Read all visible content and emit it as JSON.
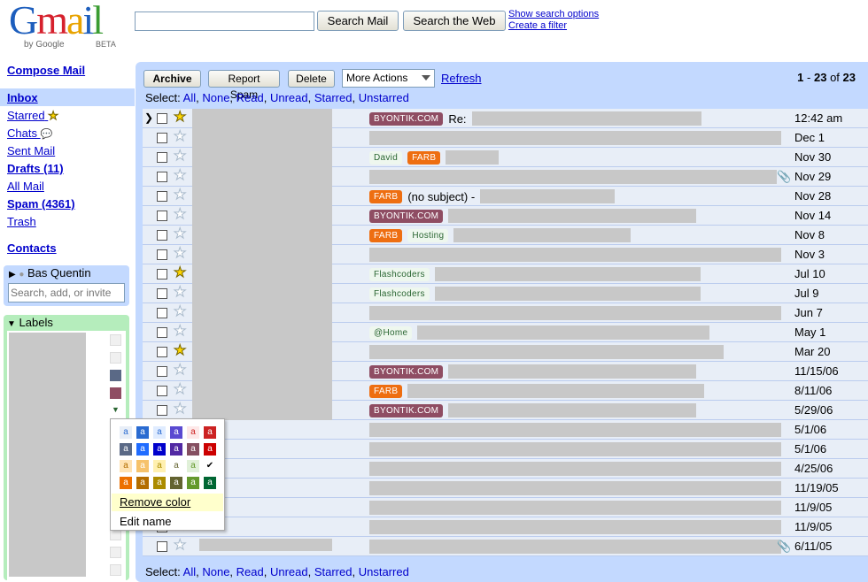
{
  "logo": {
    "text": "Gmail",
    "by": "by Google",
    "beta": "BETA"
  },
  "search": {
    "placeholder": "",
    "mail_button": "Search Mail",
    "web_button": "Search the Web",
    "options_link": "Show search options",
    "filter_link": "Create a filter"
  },
  "nav": {
    "compose": "Compose Mail",
    "inbox": "Inbox",
    "starred": "Starred",
    "chats": "Chats",
    "sent": "Sent Mail",
    "drafts": "Drafts (11)",
    "all": "All Mail",
    "spam": "Spam (4361)",
    "trash": "Trash",
    "contacts": "Contacts"
  },
  "chat": {
    "user": "Bas Quentin",
    "search_placeholder": "Search, add, or invite"
  },
  "labels_panel": {
    "title": "Labels"
  },
  "color_menu": {
    "swatch_letter": "a",
    "remove": "Remove color",
    "edit": "Edit name"
  },
  "toolbar": {
    "archive": "Archive",
    "report_spam": "Report Spam",
    "delete": "Delete",
    "more_actions": "More Actions",
    "refresh": "Refresh",
    "range_start": "1",
    "range_end": "23",
    "of": "of",
    "total": "23"
  },
  "select": {
    "label": "Select:",
    "options": [
      "All",
      "None",
      "Read",
      "Unread",
      "Starred",
      "Unstarred"
    ]
  },
  "colors": {
    "byontik": "#8f4d63",
    "farb": "#ee6e11",
    "panel_blue": "#c3d9ff",
    "labels_green": "#b5edbc"
  },
  "emails": [
    {
      "labels": [
        "BYONTIK.COM"
      ],
      "subject": "Re:",
      "date": "12:42 am",
      "starred": true,
      "unread": false,
      "current": true
    },
    {
      "labels": [],
      "subject": "",
      "date": "Dec 1",
      "starred": false
    },
    {
      "labels": [
        "David",
        "FARB"
      ],
      "subject": "",
      "date": "Nov 30",
      "starred": false
    },
    {
      "labels": [],
      "subject": "",
      "date": "Nov 29",
      "starred": false,
      "attachment": true
    },
    {
      "labels": [
        "FARB"
      ],
      "subject": "(no subject) -",
      "date": "Nov 28",
      "starred": false
    },
    {
      "labels": [
        "BYONTIK.COM"
      ],
      "subject": "",
      "date": "Nov 14",
      "starred": false
    },
    {
      "labels": [
        "FARB",
        "Hosting"
      ],
      "subject": "",
      "date": "Nov 8",
      "starred": false
    },
    {
      "labels": [],
      "subject": "",
      "date": "Nov 3",
      "starred": false
    },
    {
      "labels": [
        "Flashcoders"
      ],
      "subject": "",
      "date": "Jul 10",
      "starred": true
    },
    {
      "labels": [
        "Flashcoders"
      ],
      "subject": "",
      "date": "Jul 9",
      "starred": false
    },
    {
      "labels": [],
      "subject": "",
      "date": "Jun 7",
      "starred": false
    },
    {
      "labels": [
        "@Home"
      ],
      "subject": "",
      "date": "May 1",
      "starred": false
    },
    {
      "labels": [],
      "subject": "",
      "date": "Mar 20",
      "starred": true
    },
    {
      "labels": [
        "BYONTIK.COM"
      ],
      "subject": "",
      "date": "11/15/06",
      "starred": false
    },
    {
      "labels": [
        "FARB"
      ],
      "subject": "",
      "date": "8/11/06",
      "starred": false
    },
    {
      "labels": [
        "BYONTIK.COM"
      ],
      "subject": "",
      "date": "5/29/06",
      "starred": false
    },
    {
      "labels": [],
      "subject": "",
      "date": "5/1/06",
      "starred": false
    },
    {
      "labels": [],
      "subject": "",
      "date": "5/1/06",
      "starred": false
    },
    {
      "labels": [],
      "subject": "",
      "date": "4/25/06",
      "starred": false
    },
    {
      "labels": [],
      "subject": "",
      "date": "11/19/05",
      "starred": false
    },
    {
      "labels": [],
      "subject": "",
      "date": "11/9/05",
      "starred": false
    },
    {
      "labels": [],
      "subject": "",
      "date": "11/9/05",
      "starred": false
    },
    {
      "labels": [],
      "subject": "",
      "date": "6/11/05",
      "starred": false,
      "attachment": true
    }
  ]
}
